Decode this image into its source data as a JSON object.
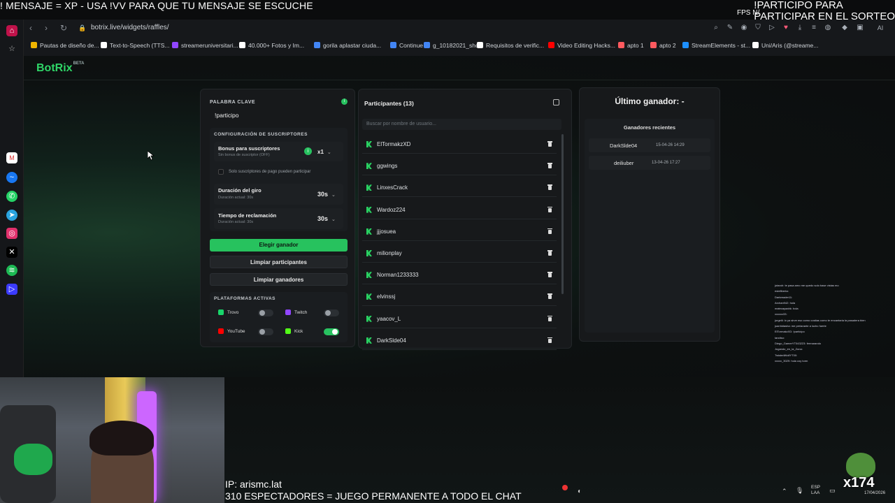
{
  "overlay": {
    "top_left": "! MENSAJE = XP - USA !VV PARA QUE TU MENSAJE SE ESCUCHE",
    "top_right_1": "!PARTICIPO PARA",
    "top_right_2": "PARTICIPAR EN EL SORTEO",
    "fps": "FPS  N/",
    "ip": "IP: arismc.lat",
    "espectadores": "310 ESPECTADORES = JUEGO PERMANENTE A TODO EL CHAT",
    "watermark": "x174",
    "clock_date": "17/04/2026",
    "lang": "ESP\nLAA"
  },
  "browser": {
    "url": "botrix.live/widgets/raffles/",
    "bookmarks": [
      {
        "label": "Pautas de diseño de...",
        "color": "#f0b400"
      },
      {
        "label": "Text-to-Speech (TTS...",
        "color": "#ffffff"
      },
      {
        "label": "streameruniversitari...",
        "color": "#9146ff"
      },
      {
        "label": "40.000+ Fotos y Im...",
        "color": "#ffffff"
      },
      {
        "label": "gorila aplastar ciuda...",
        "color": "#4285f4"
      },
      {
        "label": "Continue",
        "color": "#4285f4"
      },
      {
        "label": "g_10182021_shcc",
        "color": "#4285f4"
      },
      {
        "label": "Requisitos de verific...",
        "color": "#ffffff"
      },
      {
        "label": "Video Editing Hacks...",
        "color": "#ff0000"
      },
      {
        "label": "apto 1",
        "color": "#ff5a5f"
      },
      {
        "label": "apto 2",
        "color": "#ff5a5f"
      },
      {
        "label": "StreamElements - st...",
        "color": "#1d8fff"
      },
      {
        "label": "Uni/Aris (@streame...",
        "color": "#ffffff"
      }
    ],
    "ai_label": "AI"
  },
  "app": {
    "logo": "BotRix",
    "logo_badge": "BETA"
  },
  "settings": {
    "keyword_label": "PALABRA CLAVE",
    "keyword_value": "!participo",
    "subs_section": "CONFIGURACIÓN DE SUSCRIPTORES",
    "bonus_label": "Bonus para suscriptores",
    "bonus_sub": "Sin bonus de suscriptor (OFF)",
    "bonus_value": "x1",
    "paid_only": "Solo suscriptores de pago pueden participar",
    "spin_label": "Duración del giro",
    "spin_sub": "Duración actual: 30s",
    "spin_value": "30s",
    "claim_label": "Tiempo de reclamación",
    "claim_sub": "Duración actual: 30s",
    "claim_value": "30s",
    "btn_choose": "Elegir ganador",
    "btn_clear_participants": "Limpiar participantes",
    "btn_clear_winners": "Limpiar ganadores",
    "platforms_label": "PLATAFORMAS ACTIVAS",
    "platforms": [
      {
        "name": "Trovo",
        "enabled": false,
        "color": "#19d66b"
      },
      {
        "name": "Twitch",
        "enabled": false,
        "color": "#9146ff"
      },
      {
        "name": "YouTube",
        "enabled": false,
        "color": "#ff0000"
      },
      {
        "name": "Kick",
        "enabled": true,
        "color": "#53fc18"
      }
    ]
  },
  "participants": {
    "title": "Participantes (13)",
    "search_placeholder": "Buscar por nombre de usuario...",
    "list": [
      "ElTormakzXD",
      "ggwings",
      "LinxesCrack",
      "Wardoz224",
      "jjjosuea",
      "milionplay",
      "Norman1233333",
      "elvinssj",
      "yaacov_L",
      "DarkSlde04"
    ]
  },
  "winners": {
    "title": "Último ganador: -",
    "recent_label": "Ganadores recientes",
    "list": [
      {
        "name": "DarkSlde04",
        "date": "15-04-26 14:29"
      },
      {
        "name": "deiliuber",
        "date": "13-04-26 17:27"
      }
    ]
  },
  "chat": [
    "jotaroh: te pasa amo me quedo solo base vistas mo",
    "estefiberta: ",
    "Darkreader11: ",
    "Archan942: hola",
    "matecayaahk: hola",
    "xxxxxx33: ",
    "jorgeiii: lo ya sirve eso como cositas como te encantaria la pasadera bien",
    "juanhidasha: me perlarante a lucho fuerte",
    "ElTormakzXD: !participo",
    "tandiso: ",
    "Diego_GamerYT043223: fermarando",
    "Jugando_en_la_Zona: ",
    "TwistedWolfYT00: ",
    "xxxxx_3029: hola coy torm"
  ]
}
